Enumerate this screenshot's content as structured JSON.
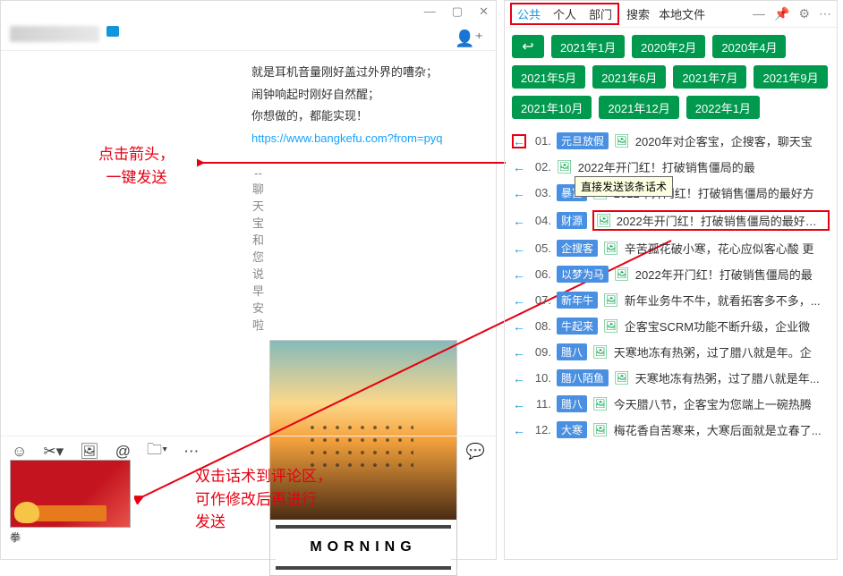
{
  "chat": {
    "line1": "就是耳机音量刚好盖过外界的嘈杂；",
    "line2": "闹钟响起时刚好自然醒；",
    "line3": "你想做的，都能实现！",
    "link": "https://www.bangkefu.com?from=pyq",
    "signature": "-- 聊天宝和您说早安啦",
    "morning_label": "MORNING",
    "thumb_caption": "拳"
  },
  "annotations": {
    "a1_l1": "点击箭头，",
    "a1_l2": "一键发送",
    "a2_l1": "双击话术到评论区，",
    "a2_l2": "可作修改后再进行",
    "a2_l3": "发送"
  },
  "side": {
    "tabs": {
      "t1": "公共",
      "t2": "个人",
      "t3": "部门"
    },
    "rest": {
      "r1": "搜索",
      "r2": "本地文件"
    },
    "tooltip": "直接发送该条话术",
    "folders": [
      "2021年1月",
      "2020年2月",
      "2020年4月",
      "2021年5月",
      "2021年6月",
      "2021年7月",
      "2021年9月",
      "2021年10月",
      "2021年12月",
      "2022年1月"
    ],
    "rows": [
      {
        "n": "01.",
        "tag": "元旦放假",
        "title": "2020年对企客宝，企搜客，聊天宝"
      },
      {
        "n": "02.",
        "tag": "",
        "title": "2022年开门红！打破销售僵局的最"
      },
      {
        "n": "03.",
        "tag": "暴富",
        "title": "2022年开门红！打破销售僵局的最好方"
      },
      {
        "n": "04.",
        "tag": "财源",
        "title": "2022年开门红！打破销售僵局的最好方..."
      },
      {
        "n": "05.",
        "tag": "企搜客",
        "title": "辛苦孤花破小寒，花心应似客心酸 更"
      },
      {
        "n": "06.",
        "tag": "以梦为马",
        "title": "2022年开门红！打破销售僵局的最"
      },
      {
        "n": "07.",
        "tag": "新年牛",
        "title": "新年业务牛不牛，就看拓客多不多，..."
      },
      {
        "n": "08.",
        "tag": "牛起来",
        "title": "企客宝SCRM功能不断升级，企业微"
      },
      {
        "n": "09.",
        "tag": "腊八",
        "title": "天寒地冻有热粥，过了腊八就是年。企"
      },
      {
        "n": "10.",
        "tag": "腊八陌鱼",
        "title": "天寒地冻有热粥，过了腊八就是年..."
      },
      {
        "n": "11.",
        "tag": "腊八",
        "title": "今天腊八节，企客宝为您端上一碗热腾"
      },
      {
        "n": "12.",
        "tag": "大寒",
        "title": "梅花香自苦寒来，大寒后面就是立春了..."
      }
    ]
  }
}
